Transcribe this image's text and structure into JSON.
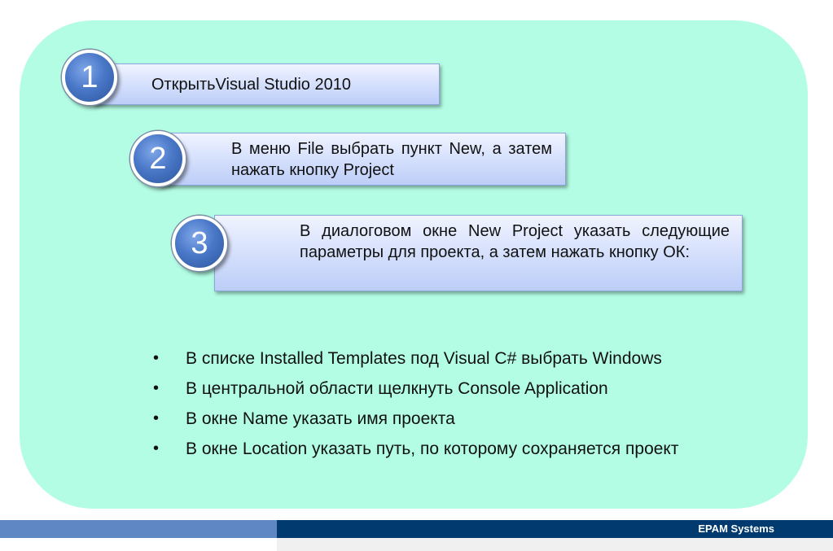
{
  "steps": [
    {
      "number": "1",
      "text": "ОткрытьVisual Studio 2010"
    },
    {
      "number": "2",
      "text": "В меню File выбрать пункт New, а затем нажать кнопку Project"
    },
    {
      "number": "3",
      "text": "В диалоговом окне New Project указать следующие параметры для проекта, а затем нажать кнопку ОК:"
    }
  ],
  "bullets": [
    "В списке Installed Templates под Visual C# выбрать Windows",
    "В центральной области щелкнуть Console Application",
    "В окне Name указать имя проекта",
    "В окне Location указать путь, по которому сохраняется проект"
  ],
  "bullet_symbol": "•",
  "footer": {
    "company": "EPAM Systems"
  },
  "colors": {
    "panel": "#b3fde4",
    "circle": "#4a78c8",
    "footer_left": "#5f87c4",
    "footer_right": "#003a6e"
  }
}
